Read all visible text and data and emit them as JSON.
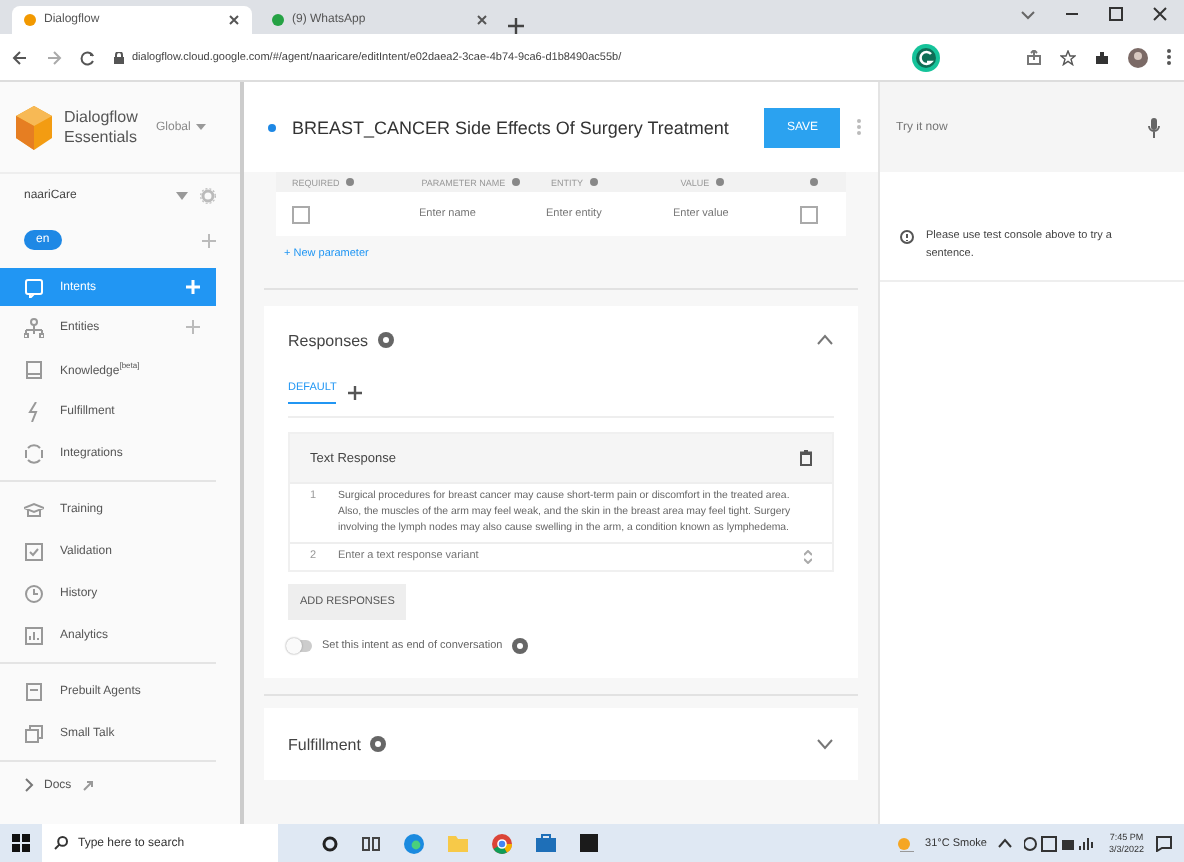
{
  "browser": {
    "tabs": [
      {
        "label": "Dialogflow",
        "selected": true
      },
      {
        "label": "(9) WhatsApp",
        "selected": false
      }
    ],
    "url": "dialogflow.cloud.google.com/#/agent/naaricare/editIntent/e02daea2-3cae-4b74-9ca6-d1b8490ac55b/"
  },
  "sidebar": {
    "brand": "Dialogflow Essentials",
    "region": "Global",
    "agent": "naariCare",
    "language": "en",
    "groups": [
      [
        {
          "label": "Intents",
          "selected": true,
          "add": true
        },
        {
          "label": "Entities",
          "selected": false,
          "add": true
        },
        {
          "label": "Knowledge",
          "sup": "[beta]",
          "selected": false,
          "add": false
        },
        {
          "label": "Fulfillment",
          "selected": false,
          "add": false
        },
        {
          "label": "Integrations",
          "selected": false,
          "add": false
        }
      ],
      [
        {
          "label": "Training",
          "selected": false,
          "add": false
        },
        {
          "label": "Validation",
          "selected": false,
          "add": false
        },
        {
          "label": "History",
          "selected": false,
          "add": false
        },
        {
          "label": "Analytics",
          "selected": false,
          "add": false
        }
      ],
      [
        {
          "label": "Prebuilt Agents",
          "selected": false,
          "add": false
        },
        {
          "label": "Small Talk",
          "selected": false,
          "add": false
        }
      ]
    ],
    "docs": "Docs"
  },
  "intent": {
    "title": "BREAST_CANCER Side Effects Of Surgery Treatment",
    "save": "SAVE"
  },
  "parameters": {
    "columns": [
      "REQUIRED",
      "PARAMETER NAME",
      "ENTITY",
      "VALUE"
    ],
    "row": {
      "required": false,
      "name_placeholder": "Enter name",
      "entity_placeholder": "Enter entity",
      "value_placeholder": "Enter value",
      "is_list": false
    },
    "new": "+ New parameter"
  },
  "responses": {
    "title": "Responses",
    "tabs": [
      {
        "label": "DEFAULT",
        "selected": true
      }
    ],
    "card_title": "Text Response",
    "variants": [
      {
        "number": "1",
        "text": "Surgical procedures for breast cancer may cause short-term pain or discomfort in the treated area. Also, the muscles of the arm may feel weak, and the skin in the breast area may feel tight. Surgery involving the lymph nodes may also cause swelling in the arm, a condition known as lymphedema."
      }
    ],
    "new_variant": {
      "number": "2",
      "placeholder": "Enter a text response variant"
    },
    "add": "ADD RESPONSES",
    "end_toggle": {
      "label": "Set this intent as end of conversation",
      "on": false
    }
  },
  "fulfillment": {
    "title": "Fulfillment"
  },
  "console": {
    "placeholder": "Try it now",
    "message": "Please use test console above to try a sentence."
  },
  "taskbar": {
    "search": "Type here to search",
    "weather": "31°C Smoke",
    "time": "7:45 PM",
    "date": "3/3/2022"
  }
}
